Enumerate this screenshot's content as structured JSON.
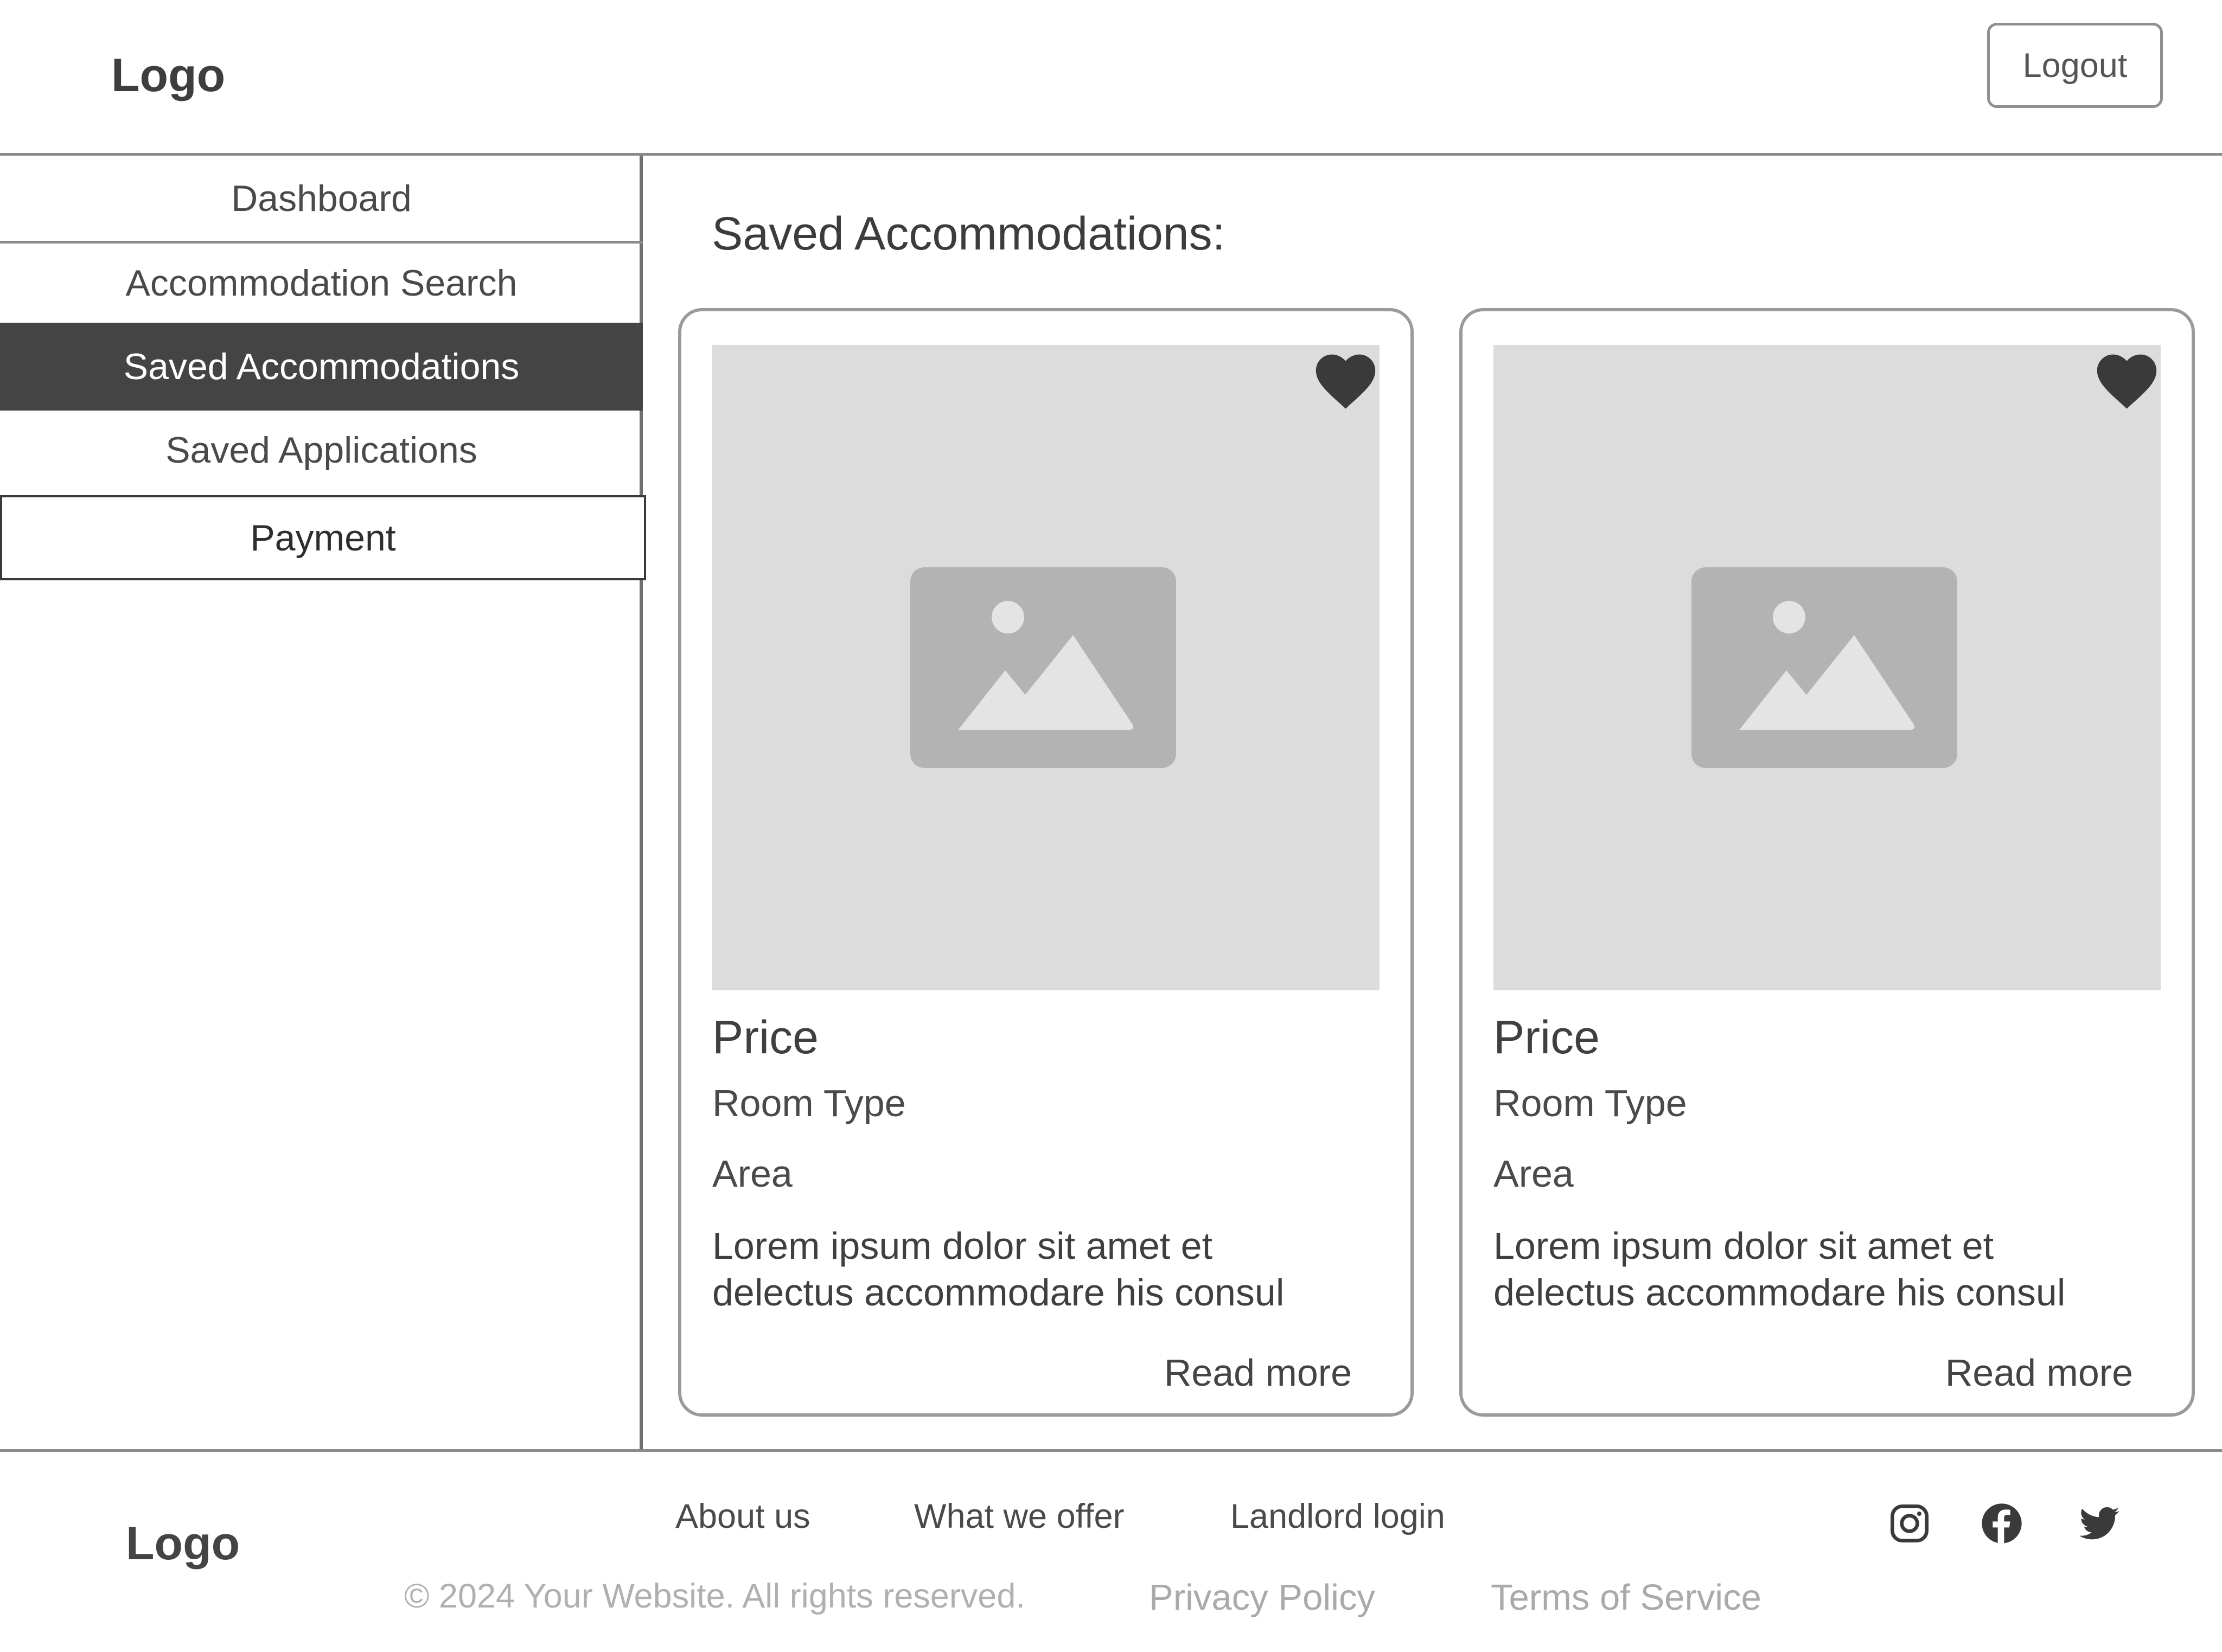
{
  "header": {
    "logo": "Logo",
    "logout_label": "Logout"
  },
  "sidebar": {
    "items": [
      {
        "label": "Dashboard"
      },
      {
        "label": "Accommodation Search"
      },
      {
        "label": "Saved Accommodations",
        "active": true
      },
      {
        "label": "Saved Applications"
      },
      {
        "label": "Payment"
      }
    ]
  },
  "main": {
    "title": "Saved Accommodations:",
    "cards": [
      {
        "image_icon": "image-placeholder-icon",
        "favorite_icon": "heart-icon",
        "price": "Price",
        "room_type": "Room Type",
        "area": "Area",
        "description": "Lorem ipsum dolor sit amet et delectus accommodare his consul",
        "read_more": "Read more"
      },
      {
        "image_icon": "image-placeholder-icon",
        "favorite_icon": "heart-icon",
        "price": "Price",
        "room_type": "Room Type",
        "area": "Area",
        "description": "Lorem ipsum dolor sit amet et delectus accommodare his consul",
        "read_more": "Read more"
      }
    ]
  },
  "footer": {
    "logo": "Logo",
    "links": [
      "About us",
      "What we offer",
      "Landlord login"
    ],
    "copyright": "© 2024 Your Website. All rights reserved.",
    "privacy": "Privacy Policy",
    "terms": "Terms of Service",
    "social_icons": [
      "instagram-icon",
      "facebook-icon",
      "twitter-icon"
    ]
  },
  "colors": {
    "active_nav_bg": "#444444",
    "image_placeholder_bg": "#dcdcdc",
    "border": "#8a8a8a"
  }
}
